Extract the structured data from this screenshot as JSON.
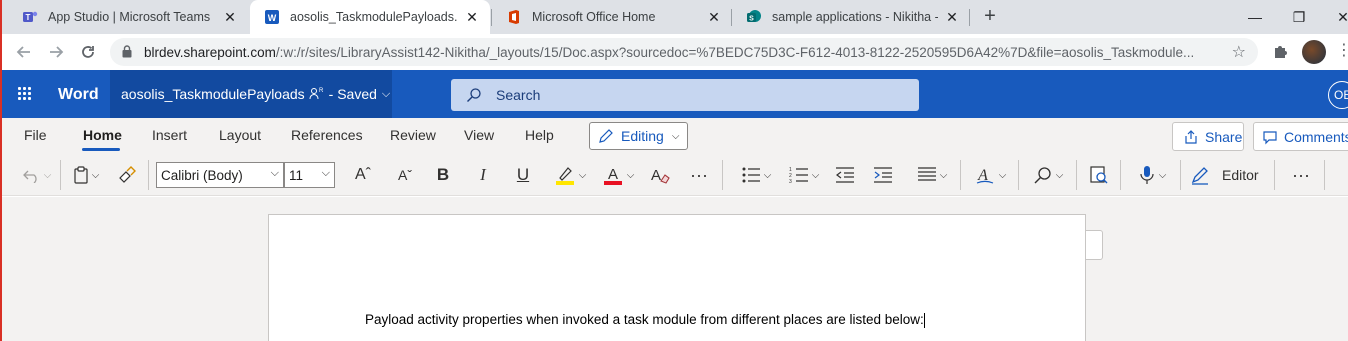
{
  "browser": {
    "tabs": [
      {
        "label": "App Studio | Microsoft Teams",
        "icon": "teams-icon",
        "close": "✕"
      },
      {
        "label": "aosolis_TaskmodulePayloads.doc",
        "icon": "word-icon",
        "close": "✕"
      },
      {
        "label": "Microsoft Office Home",
        "icon": "office-icon",
        "close": "✕"
      },
      {
        "label": "sample applications - Nikitha - D",
        "icon": "sharepoint-icon",
        "close": "✕"
      }
    ],
    "new_tab": "+",
    "window_controls": {
      "minimize": "—",
      "restore": "❐",
      "close": "✕"
    },
    "url_host": "blrdev.sharepoint.com",
    "url_path": "/:w:/r/sites/LibraryAssist142-Nikitha/_layouts/15/Doc.aspx?sourcedoc=%7BEDC75D3C-F612-4013-8122-2520595D6A42%7D&file=aosolis_Taskmodule..."
  },
  "word": {
    "app_name": "Word",
    "doc_name": "aosolis_TaskmodulePayloads",
    "save_status": "- Saved",
    "search_placeholder": "Search",
    "user_initials": "OE",
    "accent": "#185abd"
  },
  "ribbon": {
    "tabs": [
      "File",
      "Home",
      "Insert",
      "Layout",
      "References",
      "Review",
      "View",
      "Help"
    ],
    "active_tab": "Home",
    "editing_label": "Editing",
    "share_label": "Share",
    "comments_label": "Comments",
    "font_name": "Calibri (Body)",
    "font_size": "11",
    "editor_label": "Editor",
    "highlight_color": "#ffe600",
    "font_color": "#e81123"
  },
  "document": {
    "text": "Payload activity properties when invoked a task module from different places are listed below:"
  }
}
